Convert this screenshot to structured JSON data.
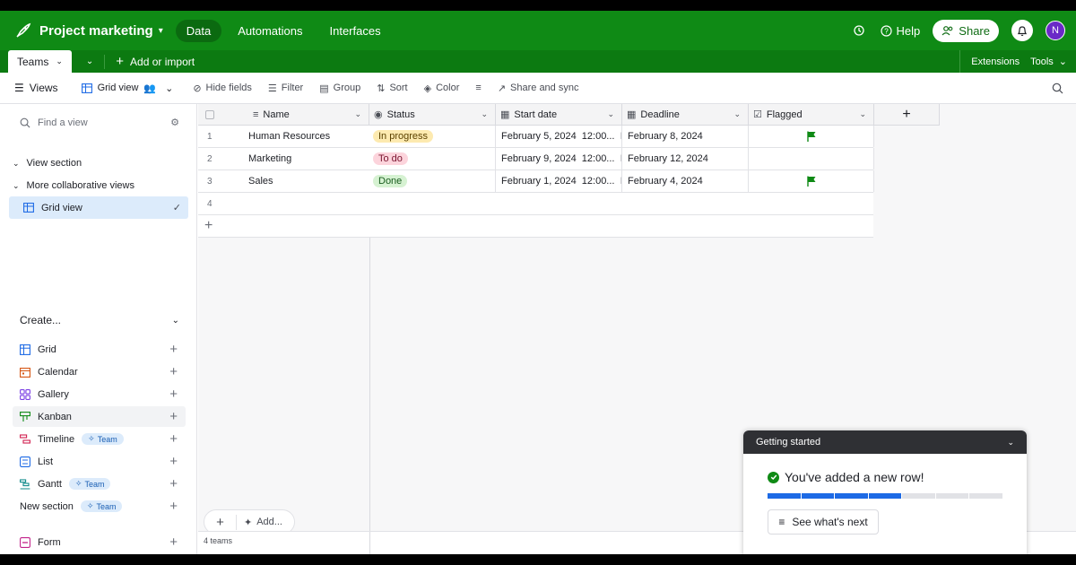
{
  "app": {
    "title": "Project marketing",
    "nav": [
      "Data",
      "Automations",
      "Interfaces"
    ],
    "active_nav": "Data",
    "help_label": "Help",
    "share_label": "Share",
    "avatar_initial": "N",
    "accent_color": "#0f8a15"
  },
  "tablebar": {
    "active_table": "Teams",
    "add_import_label": "Add or import",
    "extensions_label": "Extensions",
    "tools_label": "Tools"
  },
  "viewbar": {
    "views_label": "Views",
    "current_view": "Grid view",
    "hide_fields": "Hide fields",
    "filter": "Filter",
    "group": "Group",
    "sort": "Sort",
    "color": "Color",
    "share_sync": "Share and sync"
  },
  "sidebar": {
    "find_placeholder": "Find a view",
    "sections": [
      "View section",
      "More collaborative views"
    ],
    "active_view": "Grid view",
    "create_label": "Create...",
    "create_items": [
      {
        "label": "Grid",
        "icon": "grid-icon",
        "badge": ""
      },
      {
        "label": "Calendar",
        "icon": "calendar-icon",
        "badge": ""
      },
      {
        "label": "Gallery",
        "icon": "gallery-icon",
        "badge": ""
      },
      {
        "label": "Kanban",
        "icon": "kanban-icon",
        "badge": ""
      },
      {
        "label": "Timeline",
        "icon": "timeline-icon",
        "badge": "Team"
      },
      {
        "label": "List",
        "icon": "list-icon",
        "badge": ""
      },
      {
        "label": "Gantt",
        "icon": "gantt-icon",
        "badge": "Team"
      },
      {
        "label": "New section",
        "icon": "",
        "badge": "Team"
      },
      {
        "label": "Form",
        "icon": "form-icon",
        "badge": ""
      }
    ]
  },
  "grid": {
    "columns": [
      "Name",
      "Status",
      "Start date",
      "Deadline",
      "Flagged"
    ],
    "rows": [
      {
        "num": "1",
        "name": "Human Resources",
        "status": "In progress",
        "status_bg": "#fdeab0",
        "status_fg": "#5c4200",
        "start": "February 5, 2024",
        "start_time": "12:00...",
        "deadline": "February 8, 2024",
        "flagged": true
      },
      {
        "num": "2",
        "name": "Marketing",
        "status": "To do",
        "status_bg": "#fcd4dc",
        "status_fg": "#7a1430",
        "start": "February 9, 2024",
        "start_time": "12:00...",
        "deadline": "February 12, 2024",
        "flagged": false
      },
      {
        "num": "3",
        "name": "Sales",
        "status": "Done",
        "status_bg": "#d6f2d2",
        "status_fg": "#1b5e20",
        "start": "February 1, 2024",
        "start_time": "12:00...",
        "deadline": "February 4, 2024",
        "flagged": true
      }
    ],
    "empty_row_num": "4",
    "add_label": "Add...",
    "record_count": "4 teams"
  },
  "getting_started": {
    "title": "Getting started",
    "message": "You've added a new row!",
    "progress_done": 4,
    "progress_total": 7,
    "next_label": "See what's next"
  }
}
